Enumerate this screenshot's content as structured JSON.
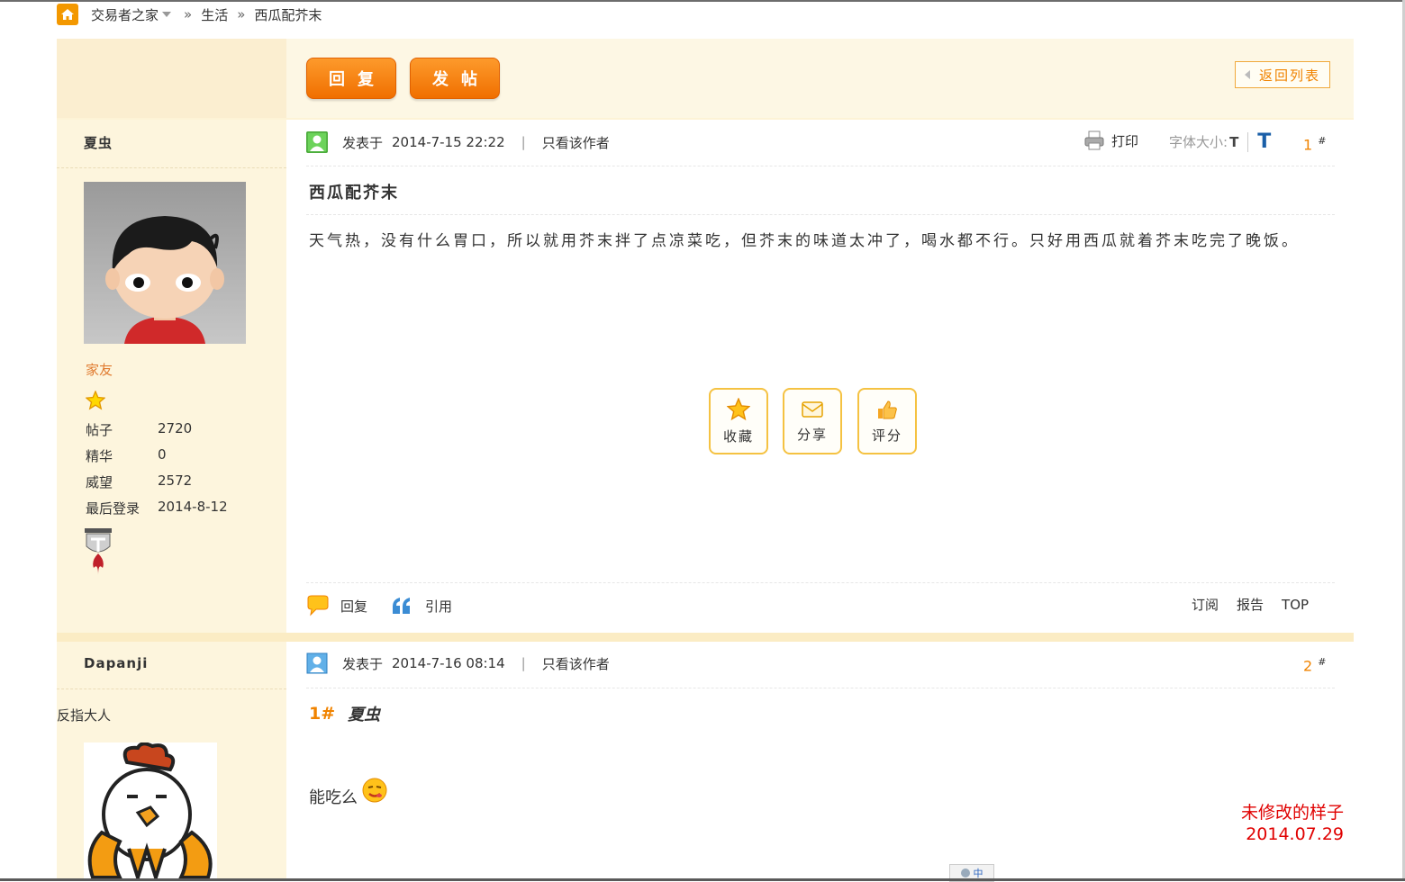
{
  "breadcrumb": {
    "site": "交易者之家",
    "sep1": "»",
    "forum": "生活",
    "sep2": "»",
    "thread": "西瓜配芥末"
  },
  "toolbar": {
    "reply_label": "回复",
    "newpost_label": "发帖",
    "back_label": "返回列表"
  },
  "post1": {
    "author": "夏虫",
    "usergroup": "家友",
    "stats": [
      {
        "label": "帖子",
        "value": "2720"
      },
      {
        "label": "精华",
        "value": "0"
      },
      {
        "label": "威望",
        "value": "2572"
      },
      {
        "label": "最后登录",
        "value": "2014-8-12"
      }
    ],
    "posted_prefix": "发表于",
    "posted_time": "2014-7-15 22:22",
    "sep": "|",
    "only_author": "只看该作者",
    "print_label": "打印",
    "fontsize_label": "字体大小:",
    "font_small": "T",
    "font_large": "T",
    "floor_num": "1",
    "floor_mark": "#",
    "title": "西瓜配芥末",
    "body": "天气热，没有什么胃口，所以就用芥末拌了点凉菜吃，但芥末的味道太冲了，喝水都不行。只好用西瓜就着芥末吃完了晚饭。",
    "actions": [
      {
        "label": "收藏",
        "icon": "star-icon"
      },
      {
        "label": "分享",
        "icon": "envelope-icon"
      },
      {
        "label": "评分",
        "icon": "thumbs-up-icon"
      }
    ],
    "footer": {
      "reply": "回复",
      "quote": "引用",
      "subscribe": "订阅",
      "report": "报告",
      "top": "TOP"
    }
  },
  "post2": {
    "author": "Dapanji",
    "custom_title": "反指大人",
    "posted_prefix": "发表于",
    "posted_time": "2014-7-16 08:14",
    "sep": "|",
    "only_author": "只看该作者",
    "floor_num": "2",
    "floor_mark": "#",
    "quote_floor": "1#",
    "quote_author": "夏虫",
    "reply_text": "能吃么"
  },
  "annotation": {
    "line1": "未修改的样子",
    "line2": "2014.07.29"
  },
  "ime": {
    "label": "中"
  },
  "colors": {
    "accent": "#f08300",
    "side_bg": "#fdf5dd",
    "button": "#f47a06",
    "annotation": "#e00000"
  }
}
